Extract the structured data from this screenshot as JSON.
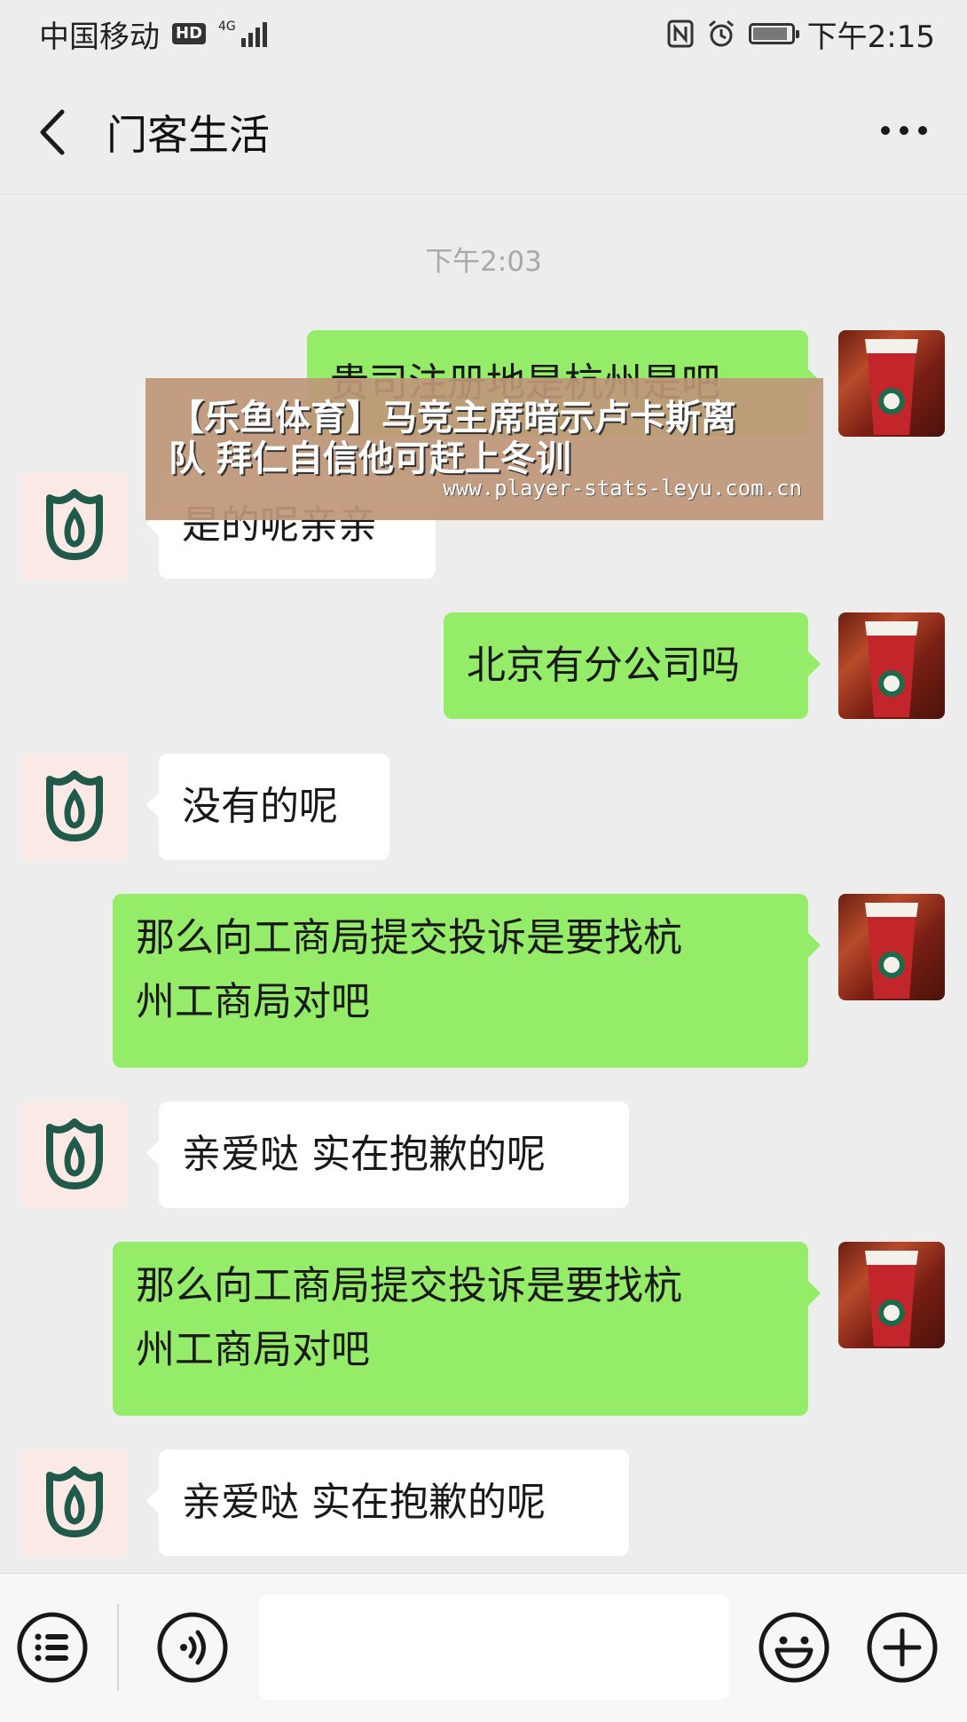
{
  "status_bar": {
    "carrier": "中国移动",
    "hd_badge": "HD",
    "network": "4G",
    "time": "下午2:15"
  },
  "nav": {
    "title": "门客生活",
    "back_icon": "chevron-left-icon",
    "more_icon": "more-dots-icon"
  },
  "chat": {
    "time_separator": "下午2:03",
    "messages": [
      {
        "side": "out",
        "text": "贵司注册地是杭州是吧"
      },
      {
        "side": "in",
        "text": "是的呢亲亲"
      },
      {
        "side": "out",
        "text": "北京有分公司吗"
      },
      {
        "side": "in",
        "text": "没有的呢"
      },
      {
        "side": "out",
        "lines": [
          "那么向工商局提交投诉是要找杭",
          "州工商局对吧"
        ]
      },
      {
        "side": "in",
        "text": "亲爱哒 实在抱歉的呢"
      },
      {
        "side": "out",
        "lines": [
          "那么向工商局提交投诉是要找杭",
          "州工商局对吧"
        ]
      },
      {
        "side": "in",
        "text": "亲爱哒 实在抱歉的呢"
      }
    ]
  },
  "watermark": {
    "line1": "【乐鱼体育】马竞主席暗示卢卡斯离",
    "line2": "队 拜仁自信他可赶上冬训",
    "url": "www.player-stats-leyu.com.cn"
  },
  "input_bar": {
    "menu_icon": "list-menu-icon",
    "voice_icon": "voice-icon",
    "emoji_icon": "emoji-icon",
    "plus_icon": "plus-icon",
    "text_value": ""
  },
  "colors": {
    "background": "#ededed",
    "outgoing_bubble": "#95ec69",
    "incoming_bubble": "#ffffff",
    "store_avatar_bg": "#fbe9e5",
    "store_logo": "#1f5a4a"
  }
}
